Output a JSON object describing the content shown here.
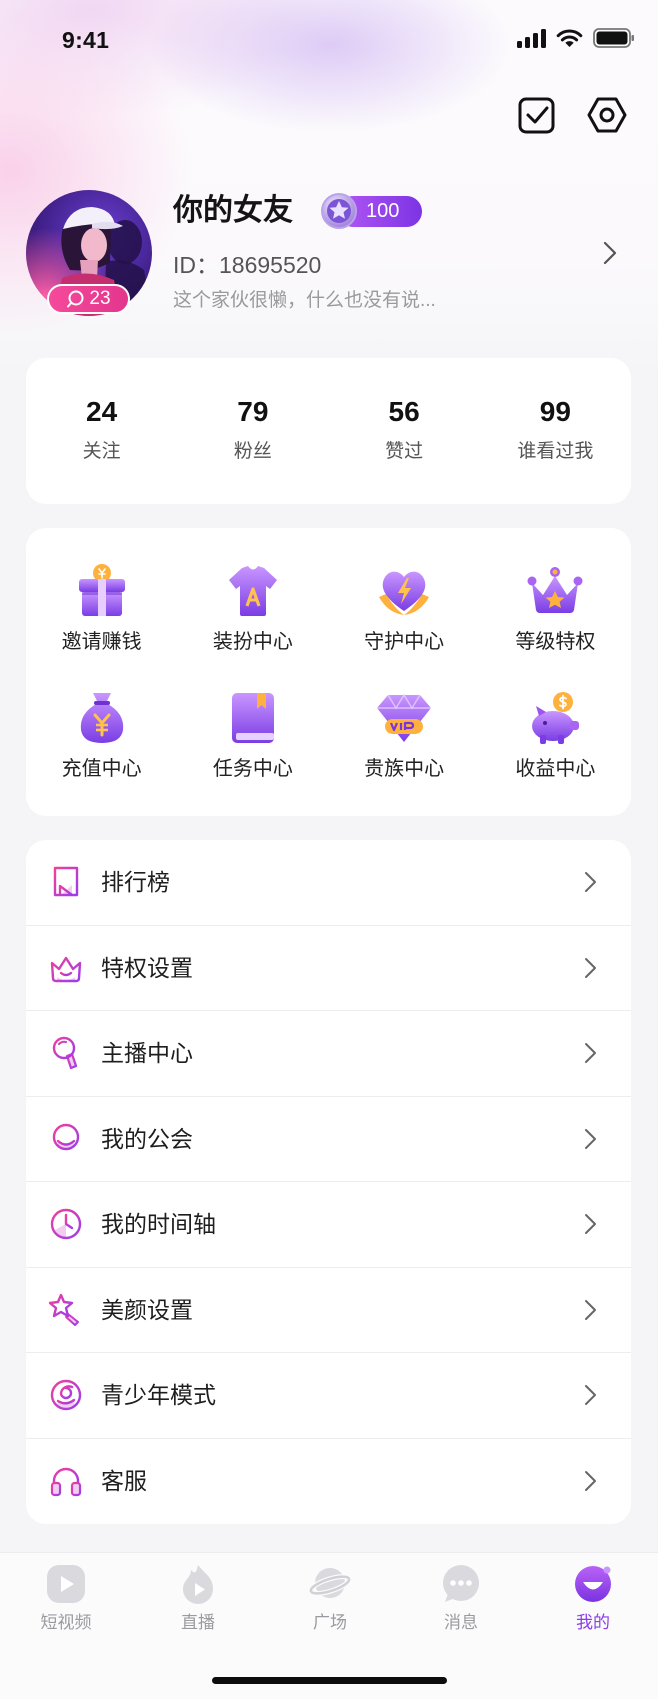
{
  "status_bar": {
    "time": "9:41"
  },
  "header": {
    "actions": [
      {
        "icon": "checkin-icon"
      },
      {
        "icon": "settings-icon"
      }
    ]
  },
  "profile": {
    "name": "你的女友",
    "level": "100",
    "id_label": "ID：",
    "id_value": "18695520",
    "bio": "这个家伙很懒，什么也没有说...",
    "avatar_badge": "23"
  },
  "stats": [
    {
      "value": "24",
      "label": "关注"
    },
    {
      "value": "79",
      "label": "粉丝"
    },
    {
      "value": "56",
      "label": "赞过"
    },
    {
      "value": "99",
      "label": "谁看过我"
    }
  ],
  "features": [
    {
      "label": "邀请赚钱",
      "icon": "gift-icon"
    },
    {
      "label": "装扮中心",
      "icon": "tshirt-icon"
    },
    {
      "label": "守护中心",
      "icon": "heart-guard-icon"
    },
    {
      "label": "等级特权",
      "icon": "crown-icon"
    },
    {
      "label": "充值中心",
      "icon": "money-bag-icon"
    },
    {
      "label": "任务中心",
      "icon": "book-icon"
    },
    {
      "label": "贵族中心",
      "icon": "diamond-vip-icon"
    },
    {
      "label": "收益中心",
      "icon": "piggy-bank-icon"
    }
  ],
  "menu": [
    {
      "label": "排行榜",
      "icon": "ranking-icon"
    },
    {
      "label": "特权设置",
      "icon": "privilege-icon"
    },
    {
      "label": "主播中心",
      "icon": "microphone-icon"
    },
    {
      "label": "我的公会",
      "icon": "guild-icon"
    },
    {
      "label": "我的时间轴",
      "icon": "clock-icon"
    },
    {
      "label": "美颜设置",
      "icon": "beauty-icon"
    },
    {
      "label": "青少年模式",
      "icon": "teen-mode-icon"
    },
    {
      "label": "客服",
      "icon": "headset-icon"
    }
  ],
  "tabbar": {
    "active": "我的",
    "items": [
      {
        "label": "短视频",
        "icon": "play-icon"
      },
      {
        "label": "直播",
        "icon": "flame-icon"
      },
      {
        "label": "广场",
        "icon": "planet-icon"
      },
      {
        "label": "消息",
        "icon": "chat-bubble-icon"
      },
      {
        "label": "我的",
        "icon": "smile-icon"
      }
    ]
  },
  "colors": {
    "accent": "#8b3de8",
    "badge_pink": "#ec3e92",
    "page_background": "#f5f5f7",
    "icon_orange": "#ffb13d"
  }
}
